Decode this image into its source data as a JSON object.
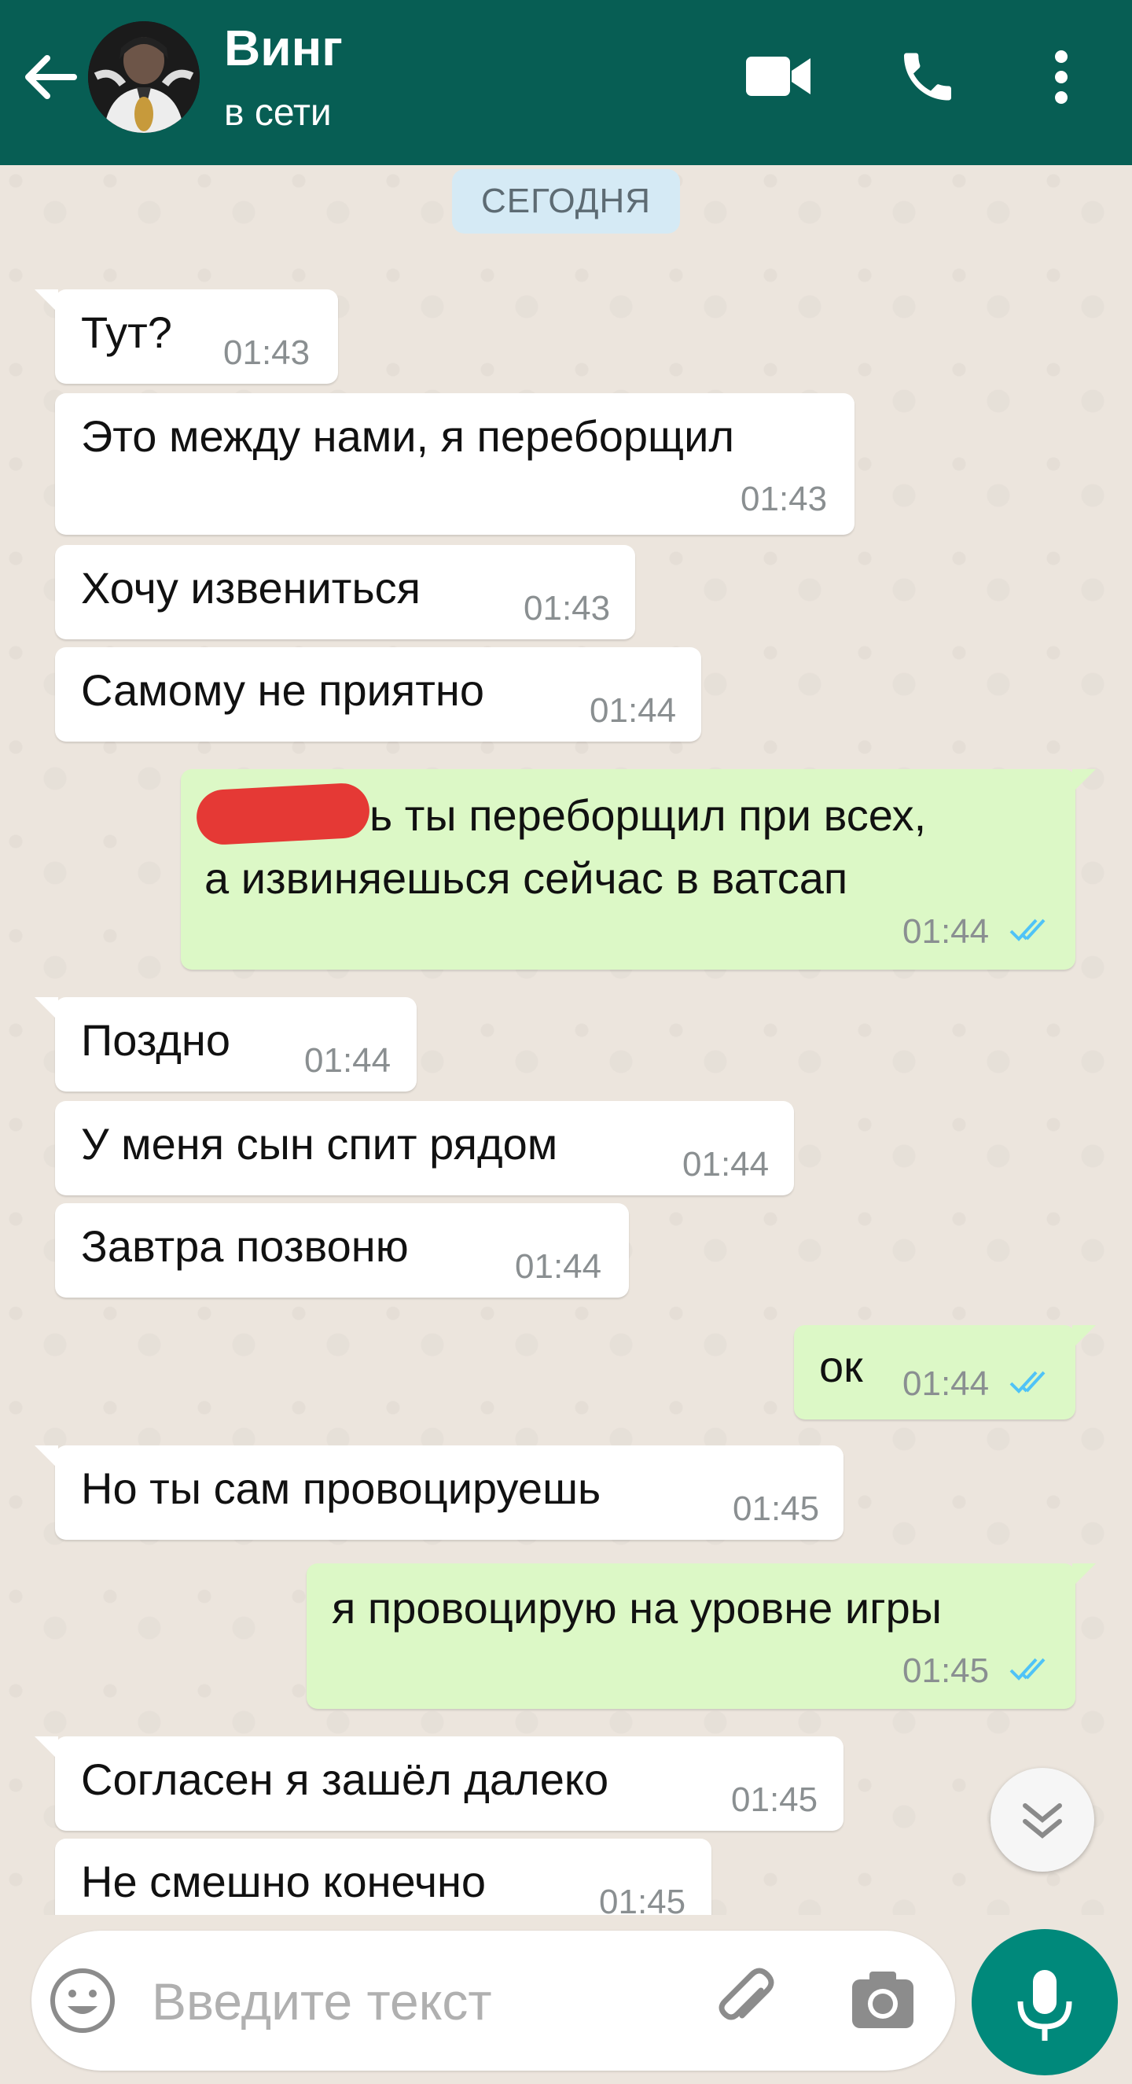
{
  "header": {
    "contact_name": "Винг",
    "status": "в сети",
    "color": "#075e54"
  },
  "chat": {
    "date_chip": "СЕГОДНЯ",
    "messages": [
      {
        "dir": "in",
        "text": "Тут?",
        "time": "01:43"
      },
      {
        "dir": "in",
        "text": "Это между нами, я переборщил",
        "time": "01:43"
      },
      {
        "dir": "in",
        "text": "Хочу извениться",
        "time": "01:43"
      },
      {
        "dir": "in",
        "text": "Самому не приятно",
        "time": "01:44"
      },
      {
        "dir": "out",
        "text_line1": "ь ты переборщил при всех,",
        "text_line2": "а извиняешься сейчас в ватсап",
        "time": "01:44",
        "status": "read"
      },
      {
        "dir": "in",
        "text": "Поздно",
        "time": "01:44"
      },
      {
        "dir": "in",
        "text": "У меня сын спит рядом",
        "time": "01:44"
      },
      {
        "dir": "in",
        "text": "Завтра позвоню",
        "time": "01:44"
      },
      {
        "dir": "out",
        "text": "ок",
        "time": "01:44",
        "status": "read"
      },
      {
        "dir": "in",
        "text": "Но ты сам провоцируешь",
        "time": "01:45"
      },
      {
        "dir": "out",
        "text": "я провоцирую на уровне игры",
        "time": "01:45",
        "status": "read"
      },
      {
        "dir": "in",
        "text": "Согласен я зашёл далеко",
        "time": "01:45"
      },
      {
        "dir": "in",
        "text": "Не смешно конечно",
        "time": "01:45"
      }
    ]
  },
  "input": {
    "placeholder": "Введите текст"
  },
  "icons": {
    "back": "arrow-left-icon",
    "video": "videocam-icon",
    "call": "phone-icon",
    "menu": "more-vert-icon",
    "emoji": "emoji-icon",
    "attach": "paperclip-icon",
    "camera": "camera-icon",
    "mic": "microphone-icon",
    "scroll": "chevron-double-down-icon",
    "read": "double-check-icon"
  },
  "colors": {
    "incoming_bubble": "#ffffff",
    "outgoing_bubble": "#dcf8c6",
    "read_ticks": "#4fc3f7",
    "mic_button": "#00897b",
    "redaction": "#e53935"
  }
}
